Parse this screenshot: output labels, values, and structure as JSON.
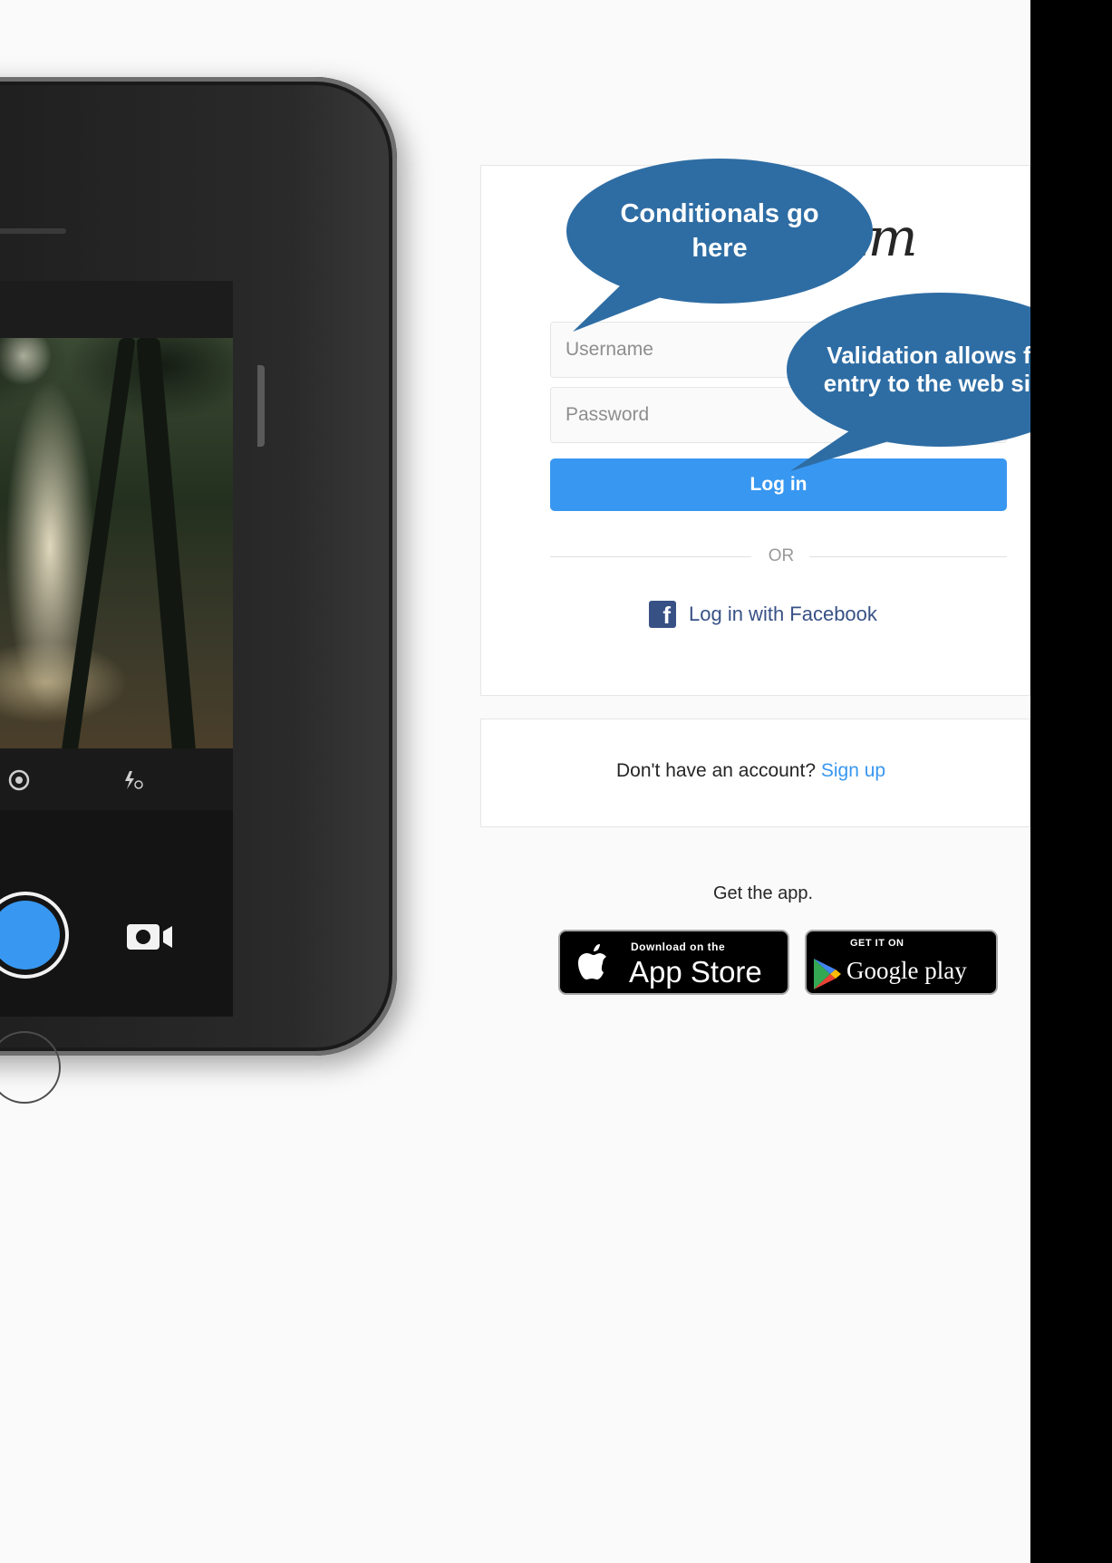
{
  "login": {
    "username_placeholder": "Username",
    "password_placeholder": "Password",
    "login_button": "Log in",
    "or_text": "OR",
    "facebook_label": "Log in with Facebook",
    "logo_fragment": "am"
  },
  "signup": {
    "prompt": "Don't have an account?",
    "link": "Sign up"
  },
  "app": {
    "get_app": "Get the app.",
    "appstore_small": "Download on the",
    "appstore_big": "App Store",
    "googleplay_small": "GET IT ON",
    "googleplay_big": "Google play"
  },
  "callouts": {
    "conditionals": "Conditionals go here",
    "validation": "Validation allows for entry to the web site."
  },
  "phone": {
    "icons": [
      "grid-icon",
      "flip-camera-icon",
      "flash-off-icon",
      "video-camera-icon"
    ]
  },
  "colors": {
    "accent": "#3897f0",
    "facebook": "#385185",
    "callout": "#2e6da4"
  }
}
